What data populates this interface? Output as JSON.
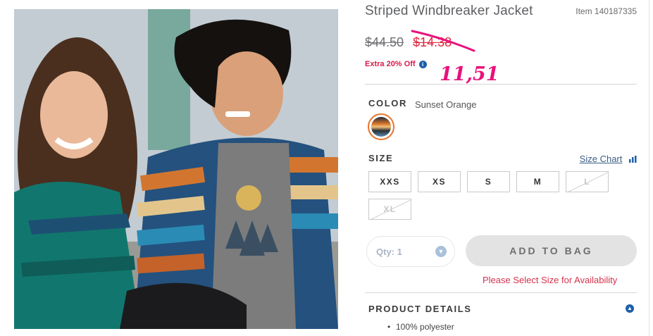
{
  "product": {
    "title": "Striped Windbreaker Jacket",
    "item_number": "Item 140187335",
    "original_price": "$44.50",
    "sale_price": "$14.38",
    "extra_offer": "Extra 20% Off",
    "info_icon": "i",
    "handwritten_note": "11,51"
  },
  "color": {
    "label": "COLOR",
    "value": "Sunset Orange",
    "accent": "#e8742c"
  },
  "size": {
    "label": "SIZE",
    "chart_link": "Size Chart",
    "options": [
      {
        "label": "XXS",
        "available": true
      },
      {
        "label": "XS",
        "available": true
      },
      {
        "label": "S",
        "available": true
      },
      {
        "label": "M",
        "available": true
      },
      {
        "label": "L",
        "available": false
      },
      {
        "label": "XL",
        "available": false
      }
    ]
  },
  "purchase": {
    "qty_label": "Qty: 1",
    "add_to_bag": "ADD TO BAG",
    "availability_warning": "Please Select Size for Availability"
  },
  "details": {
    "label": "PRODUCT DETAILS",
    "bullets": [
      "100% polyester"
    ]
  },
  "colors": {
    "sale_red": "#e0233d",
    "link_blue": "#1f5fa8",
    "handwriting_pink": "#e8127b"
  }
}
